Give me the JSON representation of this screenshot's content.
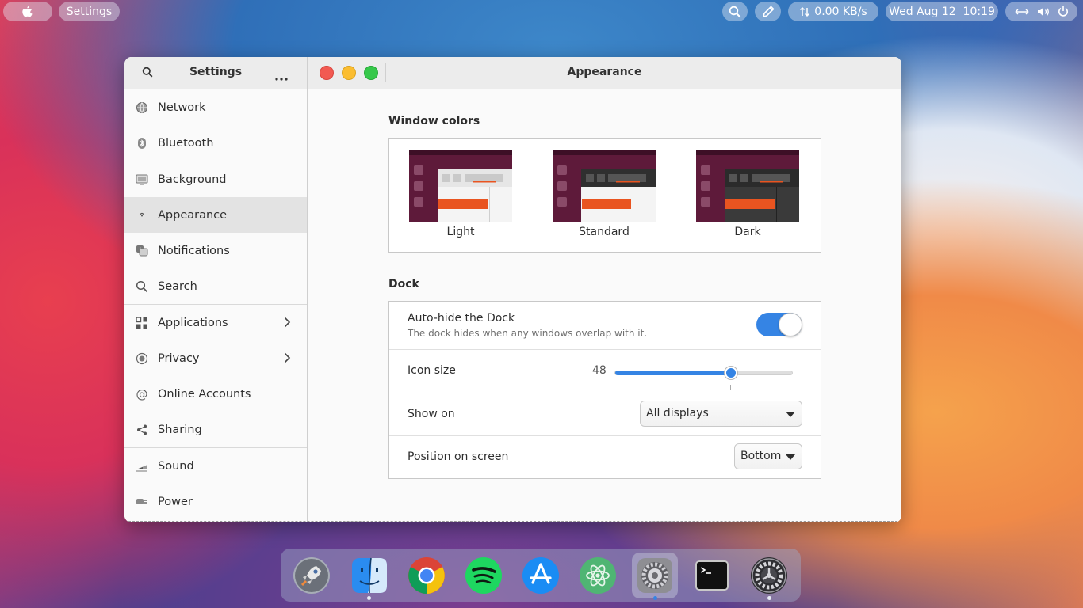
{
  "topbar": {
    "apple_icon": "apple-logo-icon",
    "app_label": "Settings",
    "search_icon": "search-icon",
    "pen_icon": "pen-icon",
    "network_speed": "0.00 KB/s",
    "clock": "Wed Aug 12  10:19",
    "system_icons": [
      "network-icon",
      "volume-icon",
      "power-icon"
    ]
  },
  "sidebar": {
    "title": "Settings",
    "items": [
      {
        "label": "Network",
        "icon": "network-globe-icon"
      },
      {
        "label": "Bluetooth",
        "icon": "bluetooth-icon"
      },
      {
        "label": "Background",
        "icon": "background-icon"
      },
      {
        "label": "Appearance",
        "icon": "appearance-icon"
      },
      {
        "label": "Notifications",
        "icon": "notifications-icon"
      },
      {
        "label": "Search",
        "icon": "search-icon"
      },
      {
        "label": "Applications",
        "icon": "applications-icon"
      },
      {
        "label": "Privacy",
        "icon": "privacy-icon"
      },
      {
        "label": "Online Accounts",
        "icon": "at-sign-icon"
      },
      {
        "label": "Sharing",
        "icon": "share-icon"
      },
      {
        "label": "Sound",
        "icon": "sound-icon"
      },
      {
        "label": "Power",
        "icon": "power-plug-icon"
      }
    ],
    "selected": "Appearance"
  },
  "main": {
    "title": "Appearance",
    "window_colors": {
      "heading": "Window colors",
      "options": [
        "Light",
        "Standard",
        "Dark"
      ]
    },
    "dock": {
      "heading": "Dock",
      "autohide_label": "Auto-hide the Dock",
      "autohide_sub": "The dock hides when any windows overlap with it.",
      "autohide_on": true,
      "icon_size_label": "Icon size",
      "icon_size_value": "48",
      "icon_size_fraction": 0.65,
      "show_on_label": "Show on",
      "show_on_value": "All displays",
      "position_label": "Position on screen",
      "position_value": "Bottom"
    }
  },
  "colors": {
    "accent": "#3584e4",
    "ubuntu_orange": "#e95420",
    "aubergine": "#5e1a3a"
  },
  "dock_apps": [
    "launchpad-icon",
    "finder-icon",
    "chrome-icon",
    "spotify-icon",
    "app-store-icon",
    "atom-icon",
    "system-preferences-icon",
    "terminal-icon",
    "settings-gear-icon"
  ]
}
